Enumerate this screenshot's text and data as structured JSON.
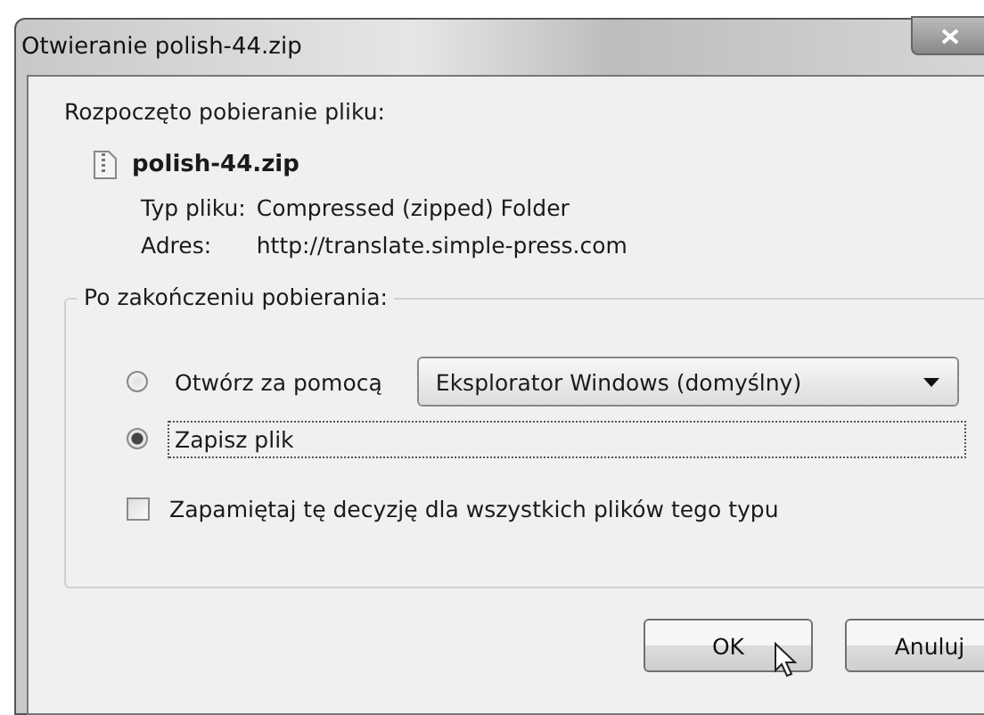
{
  "window": {
    "title": "Otwieranie polish-44.zip"
  },
  "intro": "Rozpoczęto pobieranie pliku:",
  "file": {
    "name": "polish-44.zip",
    "type_label": "Typ pliku:",
    "type_value": "Compressed (zipped) Folder",
    "address_label": "Adres:",
    "address_value": "http://translate.simple-press.com"
  },
  "group": {
    "title": "Po zakończeniu pobierania:",
    "options": [
      {
        "label": "Otwórz za pomocą",
        "selected": false,
        "kind": "dropdown",
        "dropdown_value": "Eksplorator Windows (domyślny)"
      },
      {
        "label": "Zapisz plik",
        "selected": true,
        "kind": "plain"
      }
    ],
    "remember": {
      "label": "Zapamiętaj tę decyzję dla wszystkich plików tego typu",
      "checked": false
    }
  },
  "buttons": [
    "OK",
    "Anuluj"
  ]
}
